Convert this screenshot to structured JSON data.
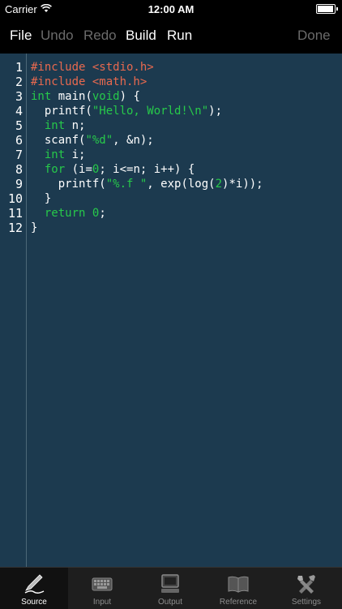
{
  "status_bar": {
    "carrier": "Carrier",
    "time": "12:00 AM",
    "battery_level": 0.95
  },
  "toolbar": {
    "file": "File",
    "undo": "Undo",
    "redo": "Redo",
    "build": "Build",
    "run": "Run",
    "done": "Done"
  },
  "editor": {
    "line_numbers": [
      "1",
      "2",
      "3",
      "4",
      "5",
      "6",
      "7",
      "8",
      "9",
      "10",
      "11",
      "12"
    ],
    "lines": [
      [
        {
          "t": "#include <stdio.h>",
          "c": "pp"
        }
      ],
      [
        {
          "t": "#include <math.h>",
          "c": "pp"
        }
      ],
      [
        {
          "t": "int",
          "c": "kw"
        },
        {
          "t": " main("
        },
        {
          "t": "void",
          "c": "kw"
        },
        {
          "t": ") {"
        }
      ],
      [
        {
          "t": "  printf("
        },
        {
          "t": "\"Hello, World!\\n\"",
          "c": "str"
        },
        {
          "t": ");"
        }
      ],
      [
        {
          "t": "  "
        },
        {
          "t": "int",
          "c": "kw"
        },
        {
          "t": " n;"
        }
      ],
      [
        {
          "t": "  scanf("
        },
        {
          "t": "\"%d\"",
          "c": "str"
        },
        {
          "t": ", &n);"
        }
      ],
      [
        {
          "t": "  "
        },
        {
          "t": "int",
          "c": "kw"
        },
        {
          "t": " i;"
        }
      ],
      [
        {
          "t": "  "
        },
        {
          "t": "for",
          "c": "kw"
        },
        {
          "t": " (i="
        },
        {
          "t": "0",
          "c": "num"
        },
        {
          "t": "; i<=n; i++) {"
        }
      ],
      [
        {
          "t": "    printf("
        },
        {
          "t": "\"%.f \"",
          "c": "str"
        },
        {
          "t": ", exp(log("
        },
        {
          "t": "2",
          "c": "num"
        },
        {
          "t": ")*i));"
        }
      ],
      [
        {
          "t": "  }"
        }
      ],
      [
        {
          "t": "  "
        },
        {
          "t": "return",
          "c": "kw"
        },
        {
          "t": " "
        },
        {
          "t": "0",
          "c": "num"
        },
        {
          "t": ";"
        }
      ],
      [
        {
          "t": "}"
        }
      ]
    ]
  },
  "tabs": [
    {
      "label": "Source",
      "icon": "pen-icon",
      "active": true
    },
    {
      "label": "Input",
      "icon": "keyboard-icon",
      "active": false
    },
    {
      "label": "Output",
      "icon": "monitor-icon",
      "active": false
    },
    {
      "label": "Reference",
      "icon": "book-icon",
      "active": false
    },
    {
      "label": "Settings",
      "icon": "tools-icon",
      "active": false
    }
  ],
  "colors": {
    "editor_bg": "#1c3a4f",
    "preprocessor": "#e8694f",
    "keyword": "#27c94a",
    "text": "#ffffff"
  }
}
